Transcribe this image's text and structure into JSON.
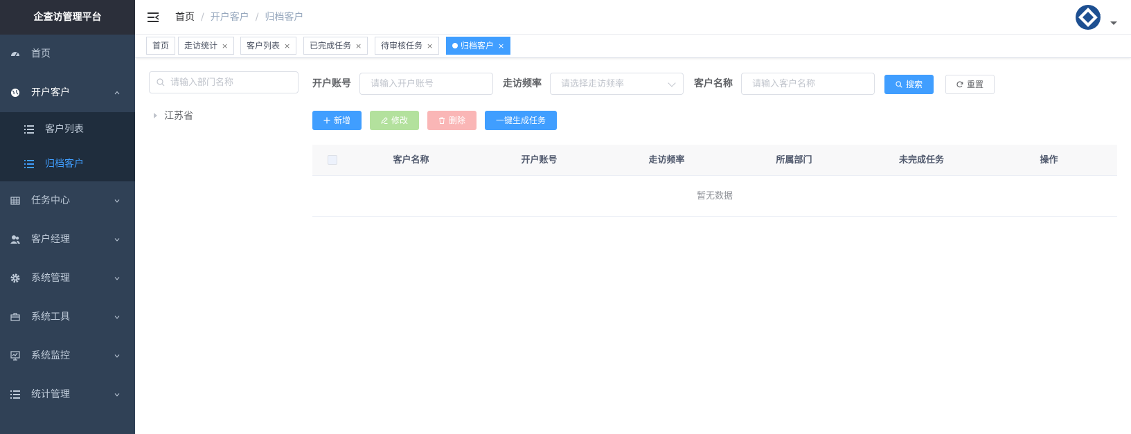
{
  "app": {
    "title": "企查访管理平台"
  },
  "sidebar": {
    "items": [
      {
        "label": "首页",
        "icon": "dashboard-icon"
      },
      {
        "label": "开户客户",
        "icon": "globe-icon",
        "expanded": true,
        "children": [
          {
            "label": "客户列表",
            "icon": "list-icon",
            "active": false
          },
          {
            "label": "归档客户",
            "icon": "list-icon",
            "active": true
          }
        ]
      },
      {
        "label": "任务中心",
        "icon": "table-icon"
      },
      {
        "label": "客户经理",
        "icon": "peoples-icon"
      },
      {
        "label": "系统管理",
        "icon": "gear-icon"
      },
      {
        "label": "系统工具",
        "icon": "toolbox-icon"
      },
      {
        "label": "系统监控",
        "icon": "monitor-icon"
      },
      {
        "label": "统计管理",
        "icon": "list-icon"
      }
    ]
  },
  "breadcrumb": [
    "首页",
    "开户客户",
    "归档客户"
  ],
  "tags": [
    {
      "label": "首页",
      "closable": false
    },
    {
      "label": "走访统计",
      "closable": true
    },
    {
      "label": "客户列表",
      "closable": true
    },
    {
      "label": "已完成任务",
      "closable": true
    },
    {
      "label": "待审核任务",
      "closable": true
    },
    {
      "label": "归档客户",
      "closable": true,
      "active": true
    }
  ],
  "tag_close": "×",
  "tree": {
    "search_placeholder": "请输入部门名称",
    "nodes": [
      "江苏省"
    ]
  },
  "search": {
    "account_label": "开户账号",
    "account_placeholder": "请输入开户账号",
    "frequency_label": "走访频率",
    "frequency_placeholder": "请选择走访频率",
    "name_label": "客户名称",
    "name_placeholder": "请输入客户名称",
    "search_button": "搜索",
    "reset_button": "重置"
  },
  "toolbar": {
    "add": "新增",
    "edit": "修改",
    "delete": "删除",
    "generate": "一键生成任务"
  },
  "table": {
    "columns": [
      "客户名称",
      "开户账号",
      "走访频率",
      "所属部门",
      "未完成任务",
      "操作"
    ],
    "rows": [],
    "empty_text": "暂无数据"
  },
  "colors": {
    "sidebar_bg": "#304156",
    "sidebar_sub_bg": "#1f2d3d",
    "primary": "#409eff",
    "success_disabled": "#b3e19d",
    "danger_disabled": "#fab6b6"
  }
}
